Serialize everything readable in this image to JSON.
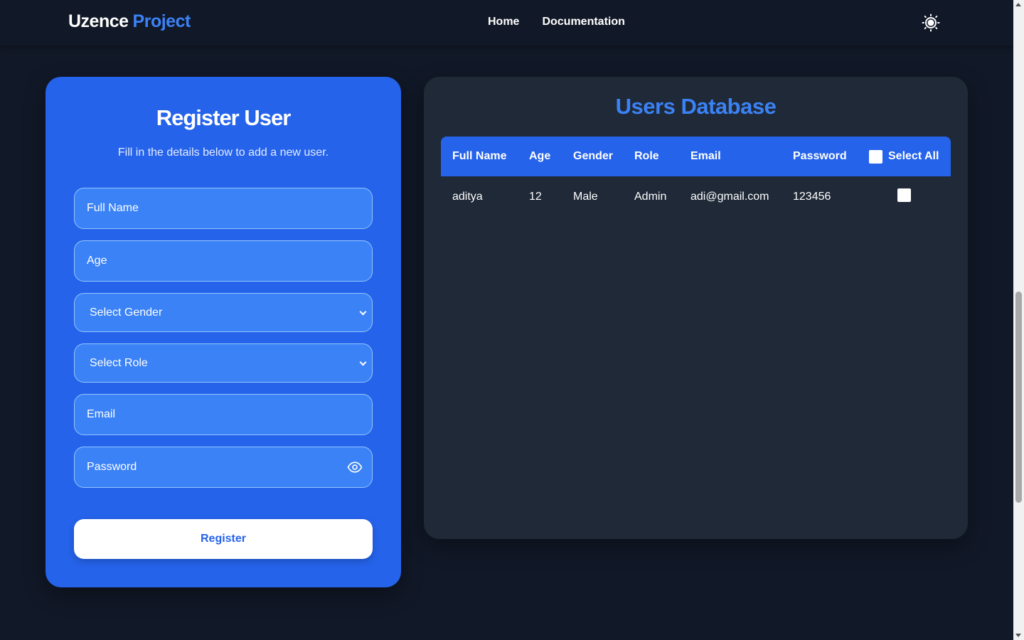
{
  "header": {
    "logo_part1": "Uzence",
    "logo_part2": "Project",
    "nav": {
      "home": "Home",
      "documentation": "Documentation"
    },
    "theme_icon": "sun-icon"
  },
  "register": {
    "title": "Register User",
    "subtitle": "Fill in the details below to add a new user.",
    "fields": {
      "full_name_placeholder": "Full Name",
      "age_placeholder": "Age",
      "gender_selected": "Select Gender",
      "role_selected": "Select Role",
      "email_placeholder": "Email",
      "password_placeholder": "Password"
    },
    "button_label": "Register",
    "colors": {
      "card": "#2563eb",
      "field": "#3b82f6"
    }
  },
  "database": {
    "title": "Users Database",
    "columns": [
      "Full Name",
      "Age",
      "Gender",
      "Role",
      "Email",
      "Password",
      "Select All"
    ],
    "rows": [
      {
        "full_name": "aditya",
        "age": "12",
        "gender": "Male",
        "role": "Admin",
        "email": "adi@gmail.com",
        "password": "123456",
        "selected": false
      }
    ],
    "select_all_checked": false,
    "colors": {
      "card": "#1f2937",
      "header": "#2563eb",
      "title": "#3b82f6"
    }
  },
  "colors": {
    "background": "#111827",
    "accent": "#3b82f6"
  }
}
